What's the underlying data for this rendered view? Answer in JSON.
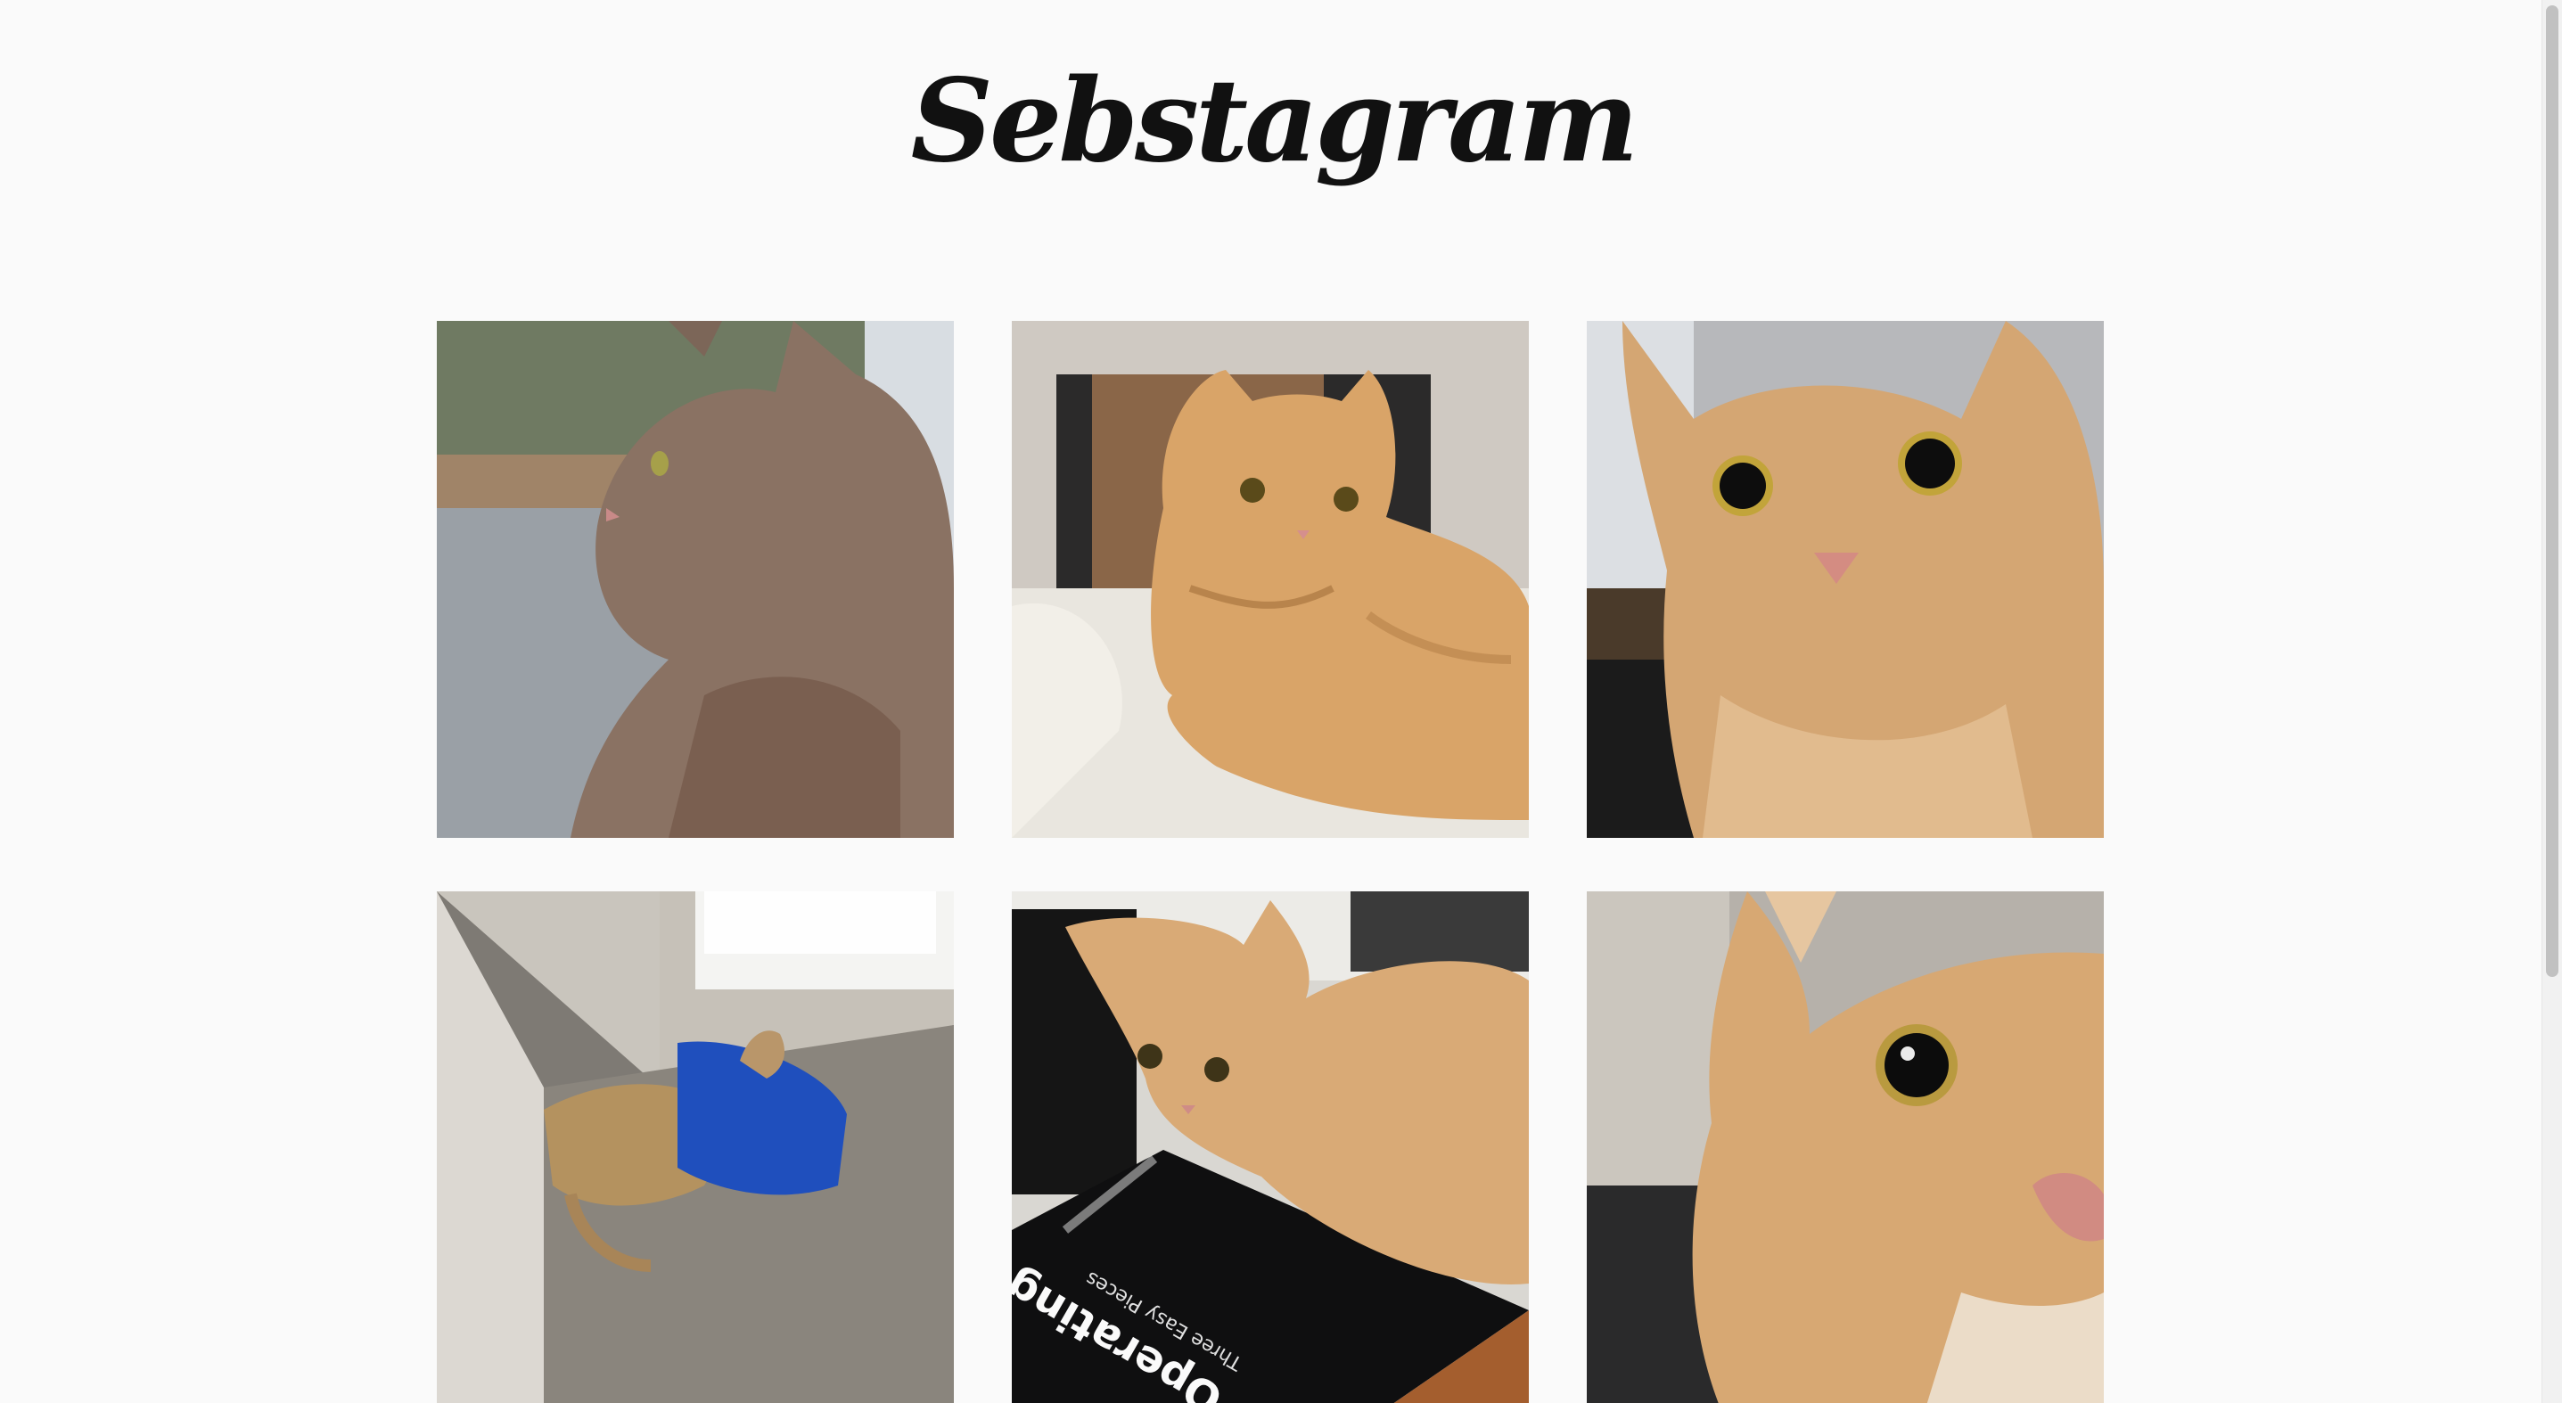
{
  "app": {
    "logo_text": "Sebstagram"
  },
  "feed": {
    "photos": [
      {
        "subject": "grey cat looking out window",
        "book_title": "",
        "book_subtitle": ""
      },
      {
        "subject": "orange tabby lying on blanket",
        "book_title": "",
        "book_subtitle": ""
      },
      {
        "subject": "orange cat close-up face",
        "book_title": "",
        "book_subtitle": ""
      },
      {
        "subject": "orange cat in blue bag on carpet",
        "book_title": "",
        "book_subtitle": ""
      },
      {
        "subject": "orange cat lying on book",
        "book_title": "Operating Systems",
        "book_subtitle": "Three Easy Pieces"
      },
      {
        "subject": "orange cat extreme close-up",
        "book_title": "",
        "book_subtitle": ""
      }
    ]
  },
  "colors": {
    "background": "#fafafa",
    "logo": "#111111",
    "orange_fur": "#d8a56e",
    "grey_fur": "#9a8070",
    "blue_bag": "#1e4fb5"
  }
}
